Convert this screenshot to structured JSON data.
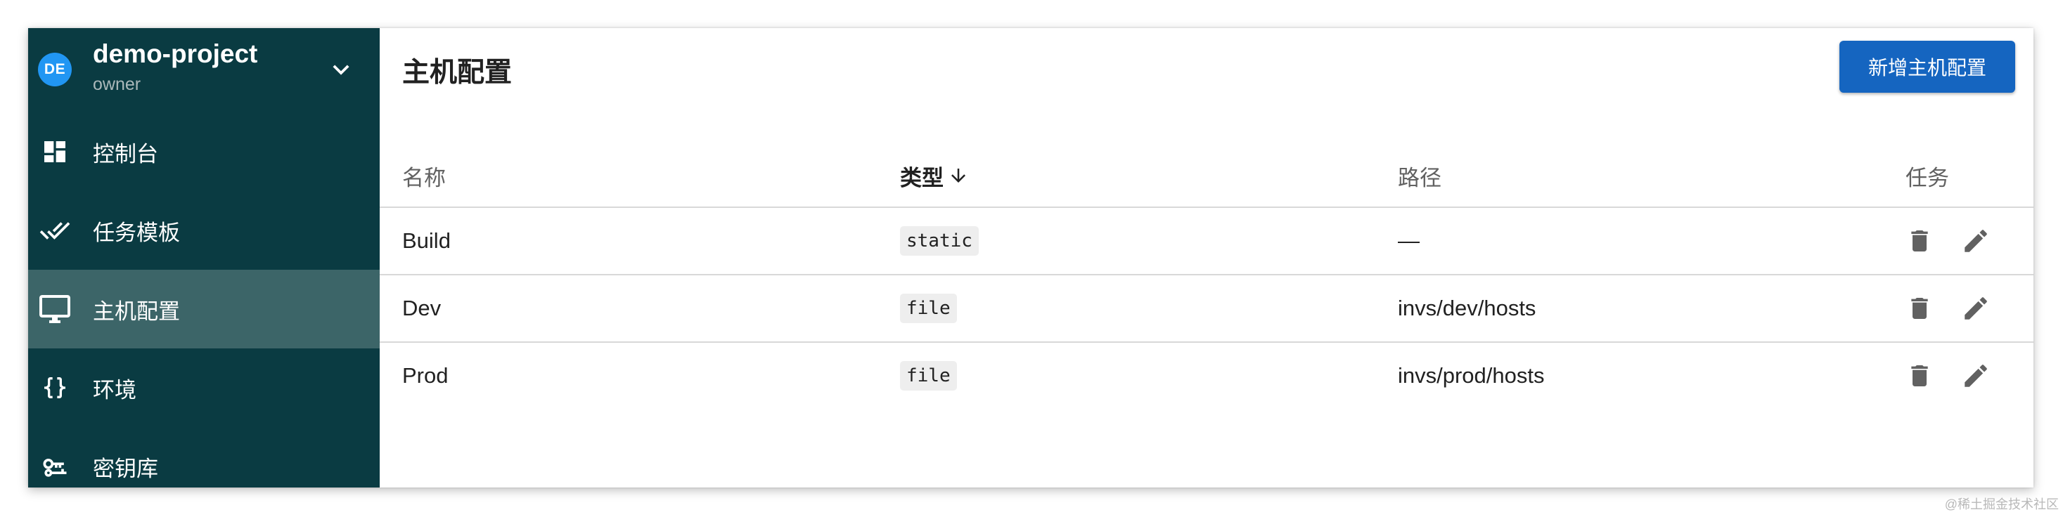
{
  "project": {
    "avatar_initials": "DE",
    "name": "demo-project",
    "role": "owner"
  },
  "sidebar": {
    "items": [
      {
        "label": "控制台",
        "icon": "dashboard-icon",
        "active": false
      },
      {
        "label": "任务模板",
        "icon": "done-all-icon",
        "active": false
      },
      {
        "label": "主机配置",
        "icon": "monitor-icon",
        "active": true
      },
      {
        "label": "环境",
        "icon": "braces-icon",
        "active": false
      },
      {
        "label": "密钥库",
        "icon": "key-icon",
        "active": false
      }
    ]
  },
  "page": {
    "title": "主机配置",
    "add_button": "新增主机配置"
  },
  "table": {
    "columns": {
      "name": "名称",
      "type": "类型",
      "path": "路径",
      "tasks": "任务"
    },
    "sorted_by": "type",
    "sort_direction": "descending",
    "rows": [
      {
        "name": "Build",
        "type": "static",
        "path": "—"
      },
      {
        "name": "Dev",
        "type": "file",
        "path": "invs/dev/hosts"
      },
      {
        "name": "Prod",
        "type": "file",
        "path": "invs/prod/hosts"
      }
    ]
  },
  "watermark": "@稀土掘金技术社区",
  "colors": {
    "sidebar_bg": "#0a3b42",
    "sidebar_active_bg": "#3c6568",
    "avatar_bg": "#2196f3",
    "primary_button": "#1565c0"
  }
}
